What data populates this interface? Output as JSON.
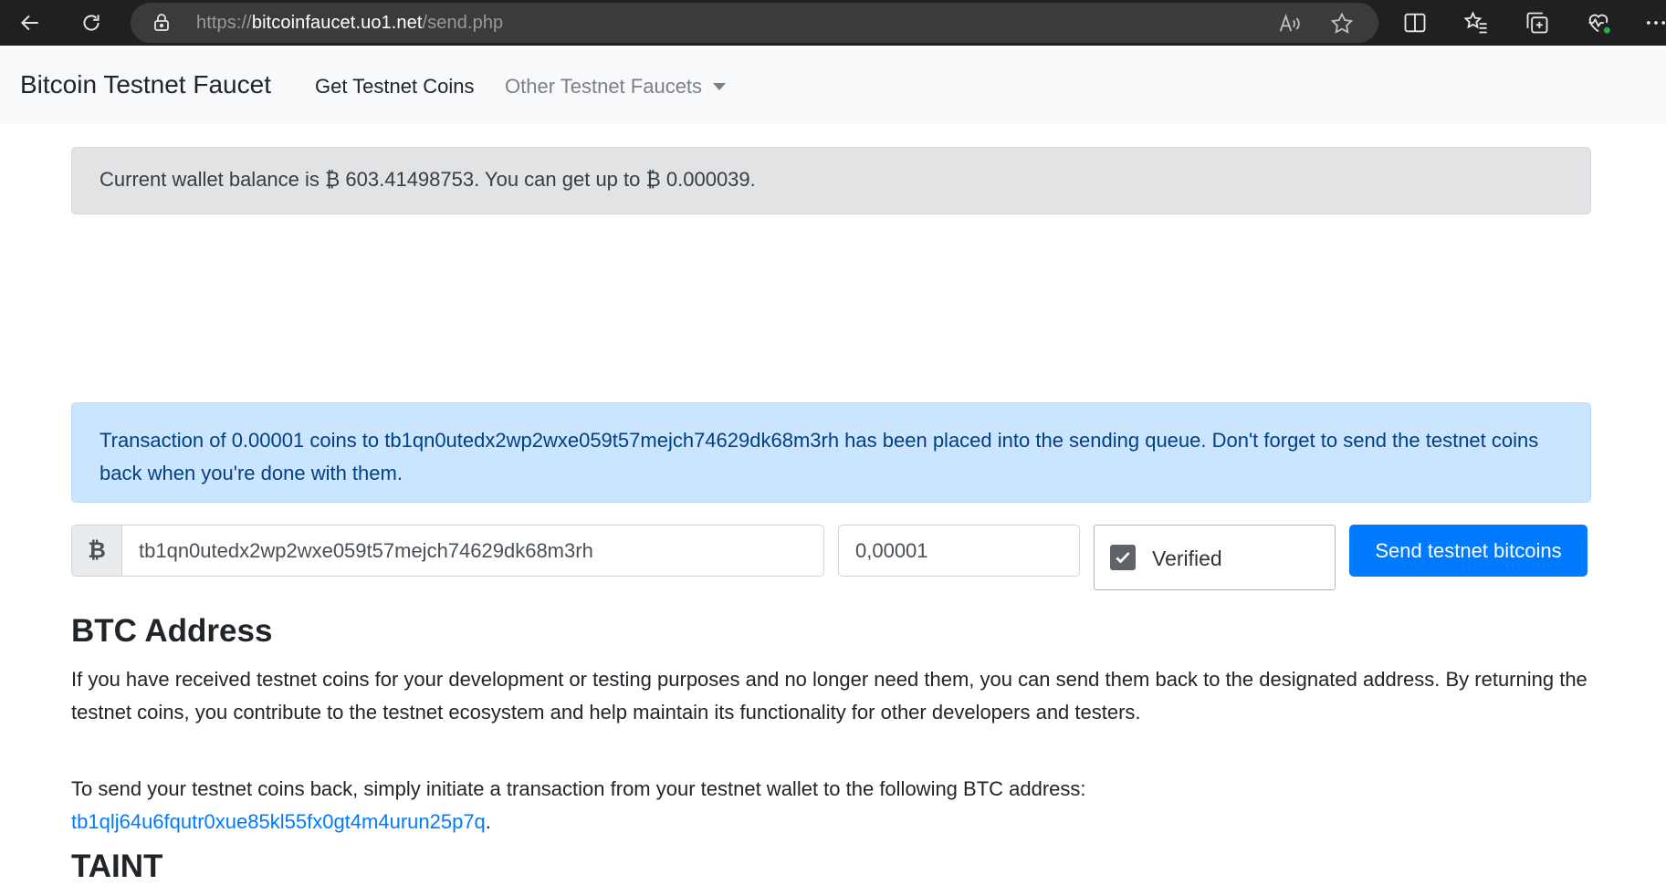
{
  "browser": {
    "url_scheme": "https://",
    "url_host": "bitcoinfaucet.uo1.net",
    "url_path": "/send.php"
  },
  "navbar": {
    "brand": "Bitcoin Testnet Faucet",
    "get_coins": "Get Testnet Coins",
    "other_faucets": "Other Testnet Faucets"
  },
  "balance": {
    "text": "Current wallet balance is ₿ 603.41498753. You can get up to ₿ 0.000039."
  },
  "info": {
    "text": "Transaction of 0.00001 coins to tb1qn0utedx2wp2wxe059t57mejch74629dk68m3rh has been placed into the sending queue. Don't forget to send the testnet coins back when you're done with them."
  },
  "form": {
    "currency_symbol": "₿",
    "address_value": "tb1qn0utedx2wp2wxe059t57mejch74629dk68m3rh",
    "amount_value": "0,00001",
    "captcha_label": "Verified",
    "send_label": "Send testnet bitcoins"
  },
  "content": {
    "title": "BTC Address",
    "para1": "If you have received testnet coins for your development or testing purposes and no longer need them, you can send them back to the designated address. By returning the testnet coins, you contribute to the testnet ecosystem and help maintain its functionality for other developers and testers.",
    "para2": "To send your testnet coins back, simply initiate a transaction from your testnet wallet to the following BTC address:",
    "return_address": "tb1qlj64u6fqutr0xue85kl55fx0gt4m4urun25p7q",
    "after_link": ".",
    "next_heading": "TAINT"
  }
}
